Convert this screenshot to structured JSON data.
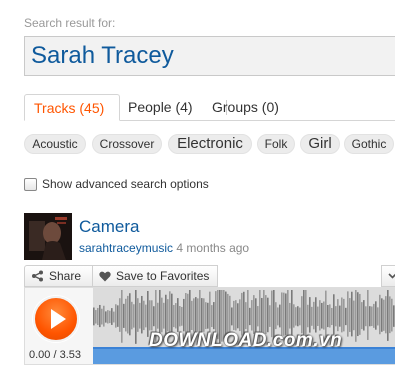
{
  "search": {
    "label": "Search result for:",
    "query": "Sarah Tracey"
  },
  "tabs": [
    {
      "label": "Tracks (45)",
      "active": true
    },
    {
      "label": "People (4)",
      "active": false
    },
    {
      "label": "Groups (0)",
      "active": false
    }
  ],
  "tags": [
    "Acoustic",
    "Crossover",
    "Electronic",
    "Folk",
    "Girl",
    "Gothic"
  ],
  "advanced_search": {
    "label": "Show advanced search options",
    "checked": false
  },
  "track": {
    "title": "Camera",
    "user": "sarahtraceymusic",
    "age": "4 months ago"
  },
  "actions": {
    "share_label": "Share",
    "favorite_label": "Save to Favorites"
  },
  "player": {
    "time": "0.00 / 3.53",
    "progress": 0.0
  },
  "watermark": "DOWNLOAD.com.vn",
  "colors": {
    "accent": "#ff5500",
    "link": "#0f5a9c"
  }
}
